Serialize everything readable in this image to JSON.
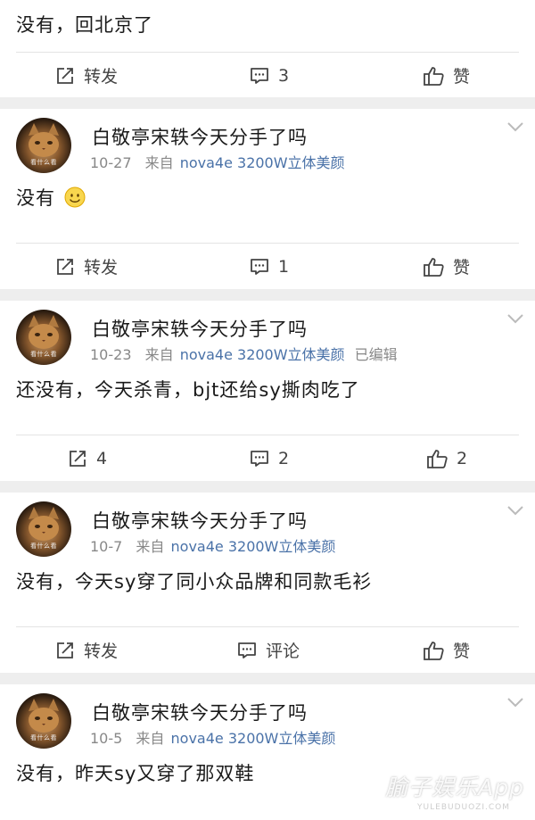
{
  "top_post": {
    "text": "没有，回北京了",
    "actions": {
      "repost": "转发",
      "comment": "3",
      "like": "赞"
    }
  },
  "posts": [
    {
      "username": "白敬亭宋轶今天分手了吗",
      "avatar_caption": "看什么看",
      "date": "10-27",
      "from_label": "来自",
      "device": "nova4e 3200W立体美颜",
      "edited": "",
      "text": "没有",
      "has_smiley": true,
      "actions": {
        "repost": "转发",
        "comment": "1",
        "like": "赞"
      }
    },
    {
      "username": "白敬亭宋轶今天分手了吗",
      "avatar_caption": "看什么看",
      "date": "10-23",
      "from_label": "来自",
      "device": "nova4e 3200W立体美颜",
      "edited": "已编辑",
      "text": "还没有，今天杀青，bjt还给sy撕肉吃了",
      "has_smiley": false,
      "actions": {
        "repost": "4",
        "comment": "2",
        "like": "2"
      }
    },
    {
      "username": "白敬亭宋轶今天分手了吗",
      "avatar_caption": "看什么看",
      "date": "10-7",
      "from_label": "来自",
      "device": "nova4e 3200W立体美颜",
      "edited": "",
      "text": "没有，今天sy穿了同小众品牌和同款毛衫",
      "has_smiley": false,
      "actions": {
        "repost": "转发",
        "comment": "评论",
        "like": "赞"
      }
    },
    {
      "username": "白敬亭宋轶今天分手了吗",
      "avatar_caption": "看什么看",
      "date": "10-5",
      "from_label": "来自",
      "device": "nova4e 3200W立体美颜",
      "edited": "",
      "text": "没有，昨天sy又穿了那双鞋",
      "has_smiley": false
    }
  ],
  "watermark": {
    "main": "腧子娱乐App",
    "sub": "YULEBUDUOZI.COM"
  },
  "colors": {
    "link_blue": "#4a72a8",
    "meta_gray": "#888888",
    "background": "#eeeeee"
  }
}
